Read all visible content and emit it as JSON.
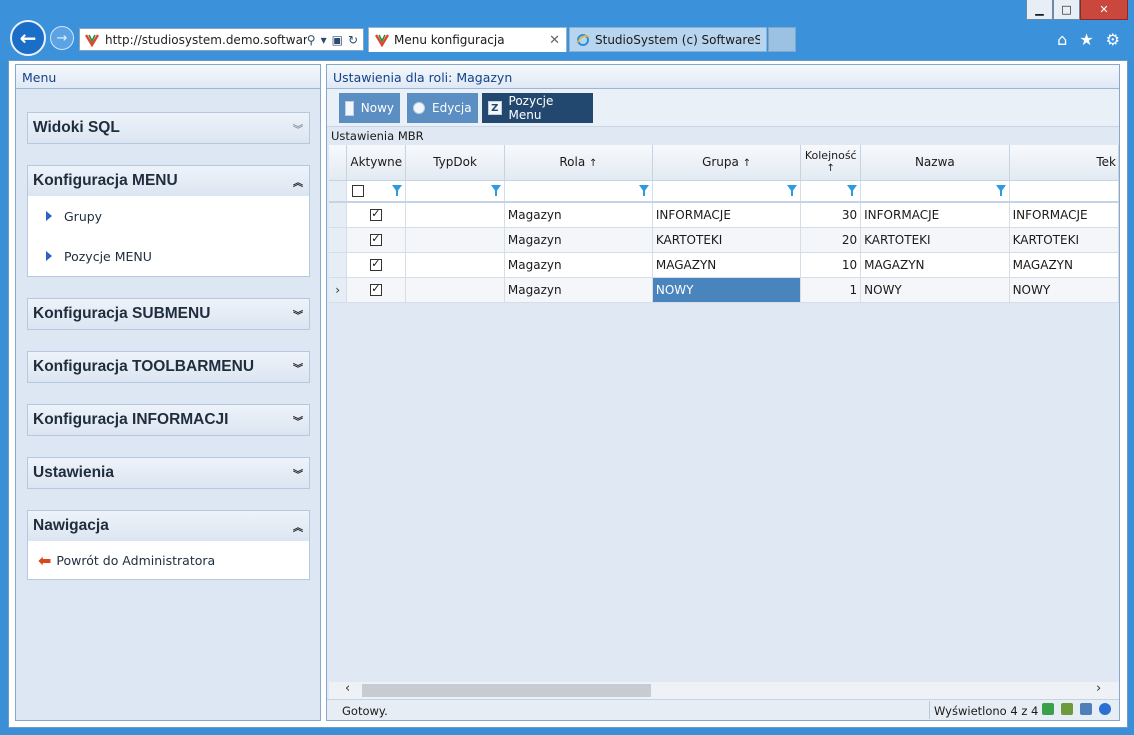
{
  "browser": {
    "address": "http://studiosystem.demo.softwar...",
    "tabs": [
      {
        "label": "Menu konfiguracja",
        "active": true
      },
      {
        "label": "StudioSystem (c) SoftwareStud...",
        "active": false
      }
    ],
    "window_buttons": {
      "minimize": "▁",
      "maximize": "□",
      "close": "✕"
    }
  },
  "left_panel": {
    "title": "Menu",
    "sections": [
      {
        "title": "Widoki SQL",
        "expanded": false,
        "items": []
      },
      {
        "title": "Konfiguracja MENU",
        "expanded": true,
        "items": [
          "Grupy",
          "Pozycje MENU"
        ]
      },
      {
        "title": "Konfiguracja SUBMENU",
        "expanded": false,
        "items": []
      },
      {
        "title": "Konfiguracja TOOLBARMENU",
        "expanded": false,
        "items": []
      },
      {
        "title": "Konfiguracja INFORMACJI",
        "expanded": false,
        "items": []
      },
      {
        "title": "Ustawienia",
        "expanded": false,
        "items": []
      },
      {
        "title": "Nawigacja",
        "expanded": true,
        "items": [
          "Powrót do Administratora"
        ]
      }
    ],
    "chevron_collapsed": "»",
    "chevron_expanded": "«"
  },
  "main": {
    "title": "Ustawienia dla roli: Magazyn",
    "toolbar": {
      "new": "Nowy",
      "edit": "Edycja",
      "menu_items": "Pozycje Menu",
      "menu_items_icon": "Z"
    },
    "grid_title": "Ustawienia MBR",
    "columns": [
      "Aktywne",
      "TypDok",
      "Rola",
      "Grupa",
      "Kolejność",
      "Nazwa",
      "Tek"
    ],
    "sort_marks": {
      "rola": "↑",
      "grupa": "↑",
      "kolejnosc": "↑"
    },
    "rows": [
      {
        "aktywne": true,
        "typdok": "",
        "rola": "Magazyn",
        "grupa": "INFORMACJE",
        "kolejnosc": "30",
        "nazwa": "INFORMACJE",
        "tekst": "INFORMACJE"
      },
      {
        "aktywne": true,
        "typdok": "",
        "rola": "Magazyn",
        "grupa": "KARTOTEKI",
        "kolejnosc": "20",
        "nazwa": "KARTOTEKI",
        "tekst": "KARTOTEKI"
      },
      {
        "aktywne": true,
        "typdok": "",
        "rola": "Magazyn",
        "grupa": "MAGAZYN",
        "kolejnosc": "10",
        "nazwa": "MAGAZYN",
        "tekst": "MAGAZYN"
      },
      {
        "aktywne": true,
        "typdok": "",
        "rola": "Magazyn",
        "grupa": "NOWY",
        "kolejnosc": "1",
        "nazwa": "NOWY",
        "tekst": "NOWY",
        "current": true
      }
    ],
    "current_row_marker": "›",
    "status": {
      "left": "Gotowy.",
      "right": "Wyświetlono 4 z 4"
    },
    "scroll": {
      "left": "‹",
      "right": "›"
    }
  }
}
